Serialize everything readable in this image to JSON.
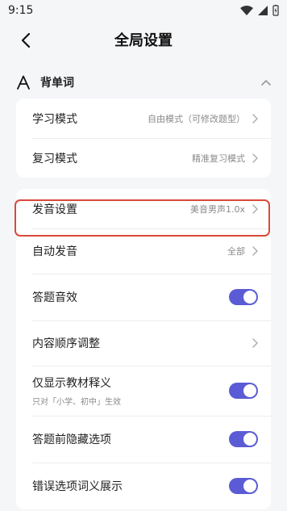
{
  "status_bar": {
    "time": "9:15"
  },
  "header": {
    "title": "全局设置"
  },
  "section": {
    "label": "背单词"
  },
  "card1": [
    {
      "label": "学习模式",
      "value": "自由模式（可修改题型）"
    },
    {
      "label": "复习模式",
      "value": "精准复习模式"
    }
  ],
  "card2": {
    "pronunciation": {
      "label": "发音设置",
      "value": "美音男声1.0x"
    },
    "auto_pronounce": {
      "label": "自动发音",
      "value": "全部"
    },
    "answer_sound": {
      "label": "答题音效",
      "toggle": "on"
    },
    "content_order": {
      "label": "内容顺序调整"
    },
    "textbook_only": {
      "label": "仅显示教材释义",
      "sub": "只对「小学、初中」生效",
      "toggle": "on"
    },
    "hide_options": {
      "label": "答题前隐藏选项",
      "toggle": "on"
    },
    "wrong_options": {
      "label": "错误选项词义展示",
      "toggle": "on"
    }
  },
  "colors": {
    "accent": "#5b5bd6",
    "highlight": "#d94a3a"
  }
}
